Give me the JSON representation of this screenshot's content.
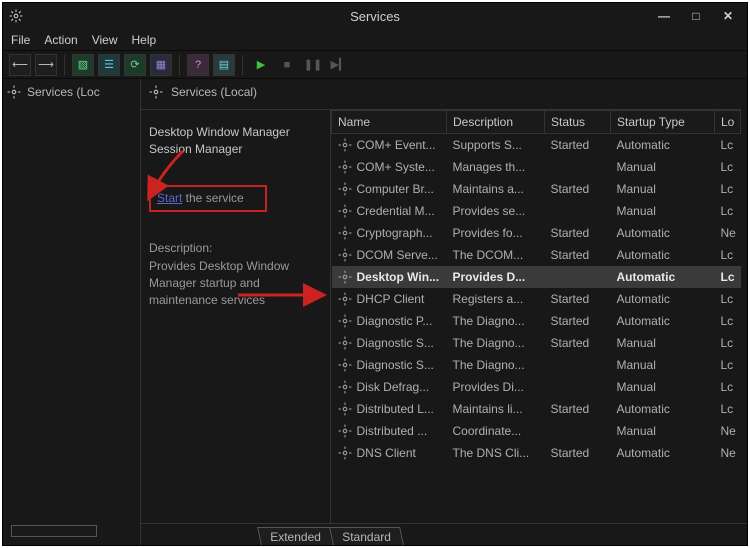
{
  "window": {
    "title": "Services",
    "controls": {
      "min": "—",
      "max": "□",
      "close": "✕"
    }
  },
  "menu": {
    "file": "File",
    "action": "Action",
    "view": "View",
    "help": "Help"
  },
  "toolbar": {
    "back": "⟵",
    "forward": "⟶",
    "app": "▧",
    "list": "☰",
    "refresh": "⟳",
    "export": "▦",
    "help": "?",
    "props": "▤",
    "play": "▶",
    "stop": "■",
    "pause": "❚❚",
    "restart": "▶▎"
  },
  "left": {
    "heading": "Services (Loc"
  },
  "rightHeader": "Services (Local)",
  "info": {
    "selectedName1": "Desktop Window Manager",
    "selectedName2": "Session Manager",
    "startLink": "Start",
    "startSuffix": " the service",
    "descLabel": "Description:",
    "desc1": "Provides Desktop Window",
    "desc2": "Manager startup and",
    "desc3": "maintenance services"
  },
  "columns": {
    "name": "Name",
    "description": "Description",
    "status": "Status",
    "startup": "Startup Type",
    "logon": "Lo"
  },
  "rows": [
    {
      "name": "COM+ Event...",
      "desc": "Supports S...",
      "status": "Started",
      "startup": "Automatic",
      "logon": "Lc"
    },
    {
      "name": "COM+ Syste...",
      "desc": "Manages th...",
      "status": "",
      "startup": "Manual",
      "logon": "Lc"
    },
    {
      "name": "Computer Br...",
      "desc": "Maintains a...",
      "status": "Started",
      "startup": "Manual",
      "logon": "Lc"
    },
    {
      "name": "Credential M...",
      "desc": "Provides se...",
      "status": "",
      "startup": "Manual",
      "logon": "Lc"
    },
    {
      "name": "Cryptograph...",
      "desc": "Provides fo...",
      "status": "Started",
      "startup": "Automatic",
      "logon": "Ne"
    },
    {
      "name": "DCOM Serve...",
      "desc": "The DCOM...",
      "status": "Started",
      "startup": "Automatic",
      "logon": "Lc"
    },
    {
      "name": "Desktop Win...",
      "desc": "Provides D...",
      "status": "",
      "startup": "Automatic",
      "logon": "Lc",
      "selected": true
    },
    {
      "name": "DHCP Client",
      "desc": "Registers a...",
      "status": "Started",
      "startup": "Automatic",
      "logon": "Lc"
    },
    {
      "name": "Diagnostic P...",
      "desc": "The Diagno...",
      "status": "Started",
      "startup": "Automatic",
      "logon": "Lc"
    },
    {
      "name": "Diagnostic S...",
      "desc": "The Diagno...",
      "status": "Started",
      "startup": "Manual",
      "logon": "Lc"
    },
    {
      "name": "Diagnostic S...",
      "desc": "The Diagno...",
      "status": "",
      "startup": "Manual",
      "logon": "Lc"
    },
    {
      "name": "Disk Defrag...",
      "desc": "Provides Di...",
      "status": "",
      "startup": "Manual",
      "logon": "Lc"
    },
    {
      "name": "Distributed L...",
      "desc": "Maintains li...",
      "status": "Started",
      "startup": "Automatic",
      "logon": "Lc"
    },
    {
      "name": "Distributed ...",
      "desc": "Coordinate...",
      "status": "",
      "startup": "Manual",
      "logon": "Ne"
    },
    {
      "name": "DNS Client",
      "desc": "The DNS Cli...",
      "status": "Started",
      "startup": "Automatic",
      "logon": "Ne"
    }
  ],
  "tabs": {
    "extended": "Extended",
    "standard": "Standard"
  }
}
